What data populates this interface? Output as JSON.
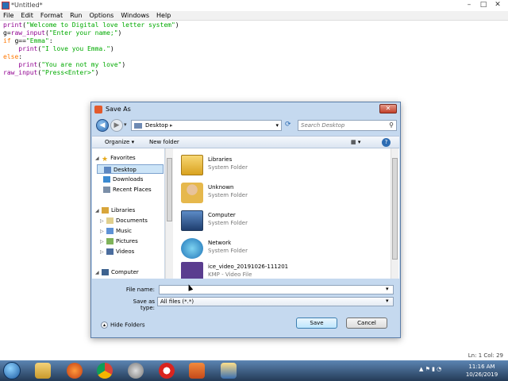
{
  "idle": {
    "title": "*Untitled*",
    "menu": [
      "File",
      "Edit",
      "Format",
      "Run",
      "Options",
      "Windows",
      "Help"
    ],
    "code_lines": [
      [
        [
          "bi",
          "print"
        ],
        [
          "plain",
          "("
        ],
        [
          "str",
          "\"Welcome to Digital love letter system\""
        ],
        [
          "plain",
          ")"
        ]
      ],
      [
        [
          "plain",
          "g="
        ],
        [
          "bi",
          "raw_input"
        ],
        [
          "plain",
          "("
        ],
        [
          "str",
          "\"Enter your name;\""
        ],
        [
          "plain",
          ")"
        ]
      ],
      [
        [
          "kw",
          "if"
        ],
        [
          "plain",
          " g=="
        ],
        [
          "str",
          "\"Emma\""
        ],
        [
          "plain",
          ":"
        ]
      ],
      [
        [
          "plain",
          "    "
        ],
        [
          "bi",
          "print"
        ],
        [
          "plain",
          "("
        ],
        [
          "str",
          "\"I love you Emma.\""
        ],
        [
          "plain",
          ")"
        ]
      ],
      [
        [
          "kw",
          "else"
        ],
        [
          "plain",
          ":"
        ]
      ],
      [
        [
          "plain",
          "    "
        ],
        [
          "bi",
          "print"
        ],
        [
          "plain",
          "("
        ],
        [
          "str",
          "\"You are not my love\""
        ],
        [
          "plain",
          ")"
        ]
      ],
      [
        [
          "bi",
          "raw_input"
        ],
        [
          "plain",
          "("
        ],
        [
          "str",
          "\"Press<Enter>\""
        ],
        [
          "plain",
          ")"
        ]
      ]
    ],
    "status": "Ln: 1  Col: 29"
  },
  "dialog": {
    "title": "Save As",
    "location": "Desktop",
    "search_placeholder": "Search Desktop",
    "organize_label": "Organize ▾",
    "new_folder_label": "New folder",
    "nav": {
      "favorites_label": "Favorites",
      "favorites": [
        "Desktop",
        "Downloads",
        "Recent Places"
      ],
      "libraries_label": "Libraries",
      "libraries": [
        "Documents",
        "Music",
        "Pictures",
        "Videos"
      ],
      "computer_label": "Computer"
    },
    "files": [
      {
        "name": "Libraries",
        "type": "System Folder",
        "icon": "libraries-icon"
      },
      {
        "name": "Unknown",
        "type": "System Folder",
        "icon": "user-folder-icon"
      },
      {
        "name": "Computer",
        "type": "System Folder",
        "icon": "computer-icon"
      },
      {
        "name": "Network",
        "type": "System Folder",
        "icon": "network-icon"
      },
      {
        "name": "ice_video_20191026-111201",
        "type": "KMP - Video File",
        "icon": "video-file-icon"
      }
    ],
    "file_name_label": "File name:",
    "file_name_value": "",
    "save_type_label": "Save as type:",
    "save_type_value": "All files (*.*)",
    "hide_folders_label": "Hide Folders",
    "save_label": "Save",
    "cancel_label": "Cancel"
  },
  "taskbar": {
    "time": "11:16 AM",
    "date": "10/26/2019"
  }
}
